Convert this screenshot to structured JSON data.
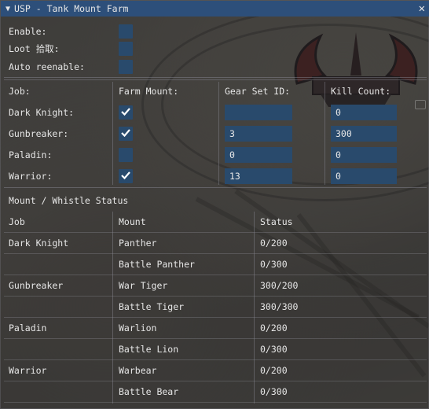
{
  "window": {
    "title": "USP - Tank Mount Farm"
  },
  "settings": [
    {
      "label": "Enable:",
      "checked": false
    },
    {
      "label": "Loot 拾取:",
      "checked": false
    },
    {
      "label": "Auto reenable:",
      "checked": false
    }
  ],
  "job_table": {
    "headers": [
      "Job:",
      "Farm Mount:",
      "Gear Set ID:",
      "Kill Count:"
    ],
    "rows": [
      {
        "job": "Dark Knight:",
        "farm": true,
        "gear": "",
        "kills": "0"
      },
      {
        "job": "Gunbreaker:",
        "farm": true,
        "gear": "3",
        "kills": "300"
      },
      {
        "job": "Paladin:",
        "farm": false,
        "gear": "0",
        "kills": "0"
      },
      {
        "job": "Warrior:",
        "farm": true,
        "gear": "13",
        "kills": "0"
      }
    ]
  },
  "status_section": {
    "title": "Mount / Whistle Status",
    "headers": [
      "Job",
      "Mount",
      "Status"
    ],
    "rows": [
      {
        "job": "Dark Knight",
        "mount": "Panther",
        "status": "0/200"
      },
      {
        "job": "",
        "mount": "Battle Panther",
        "status": "0/300"
      },
      {
        "job": "Gunbreaker",
        "mount": "War Tiger",
        "status": "300/200"
      },
      {
        "job": "",
        "mount": "Battle Tiger",
        "status": "300/300"
      },
      {
        "job": "Paladin",
        "mount": "Warlion",
        "status": "0/200"
      },
      {
        "job": "",
        "mount": "Battle Lion",
        "status": "0/300"
      },
      {
        "job": "Warrior",
        "mount": "Warbear",
        "status": "0/200"
      },
      {
        "job": "",
        "mount": "Battle Bear",
        "status": "0/300"
      }
    ]
  },
  "colors": {
    "titlebar": "#2d4f7a",
    "field": "#294a6c",
    "text": "#e6e6e6"
  }
}
